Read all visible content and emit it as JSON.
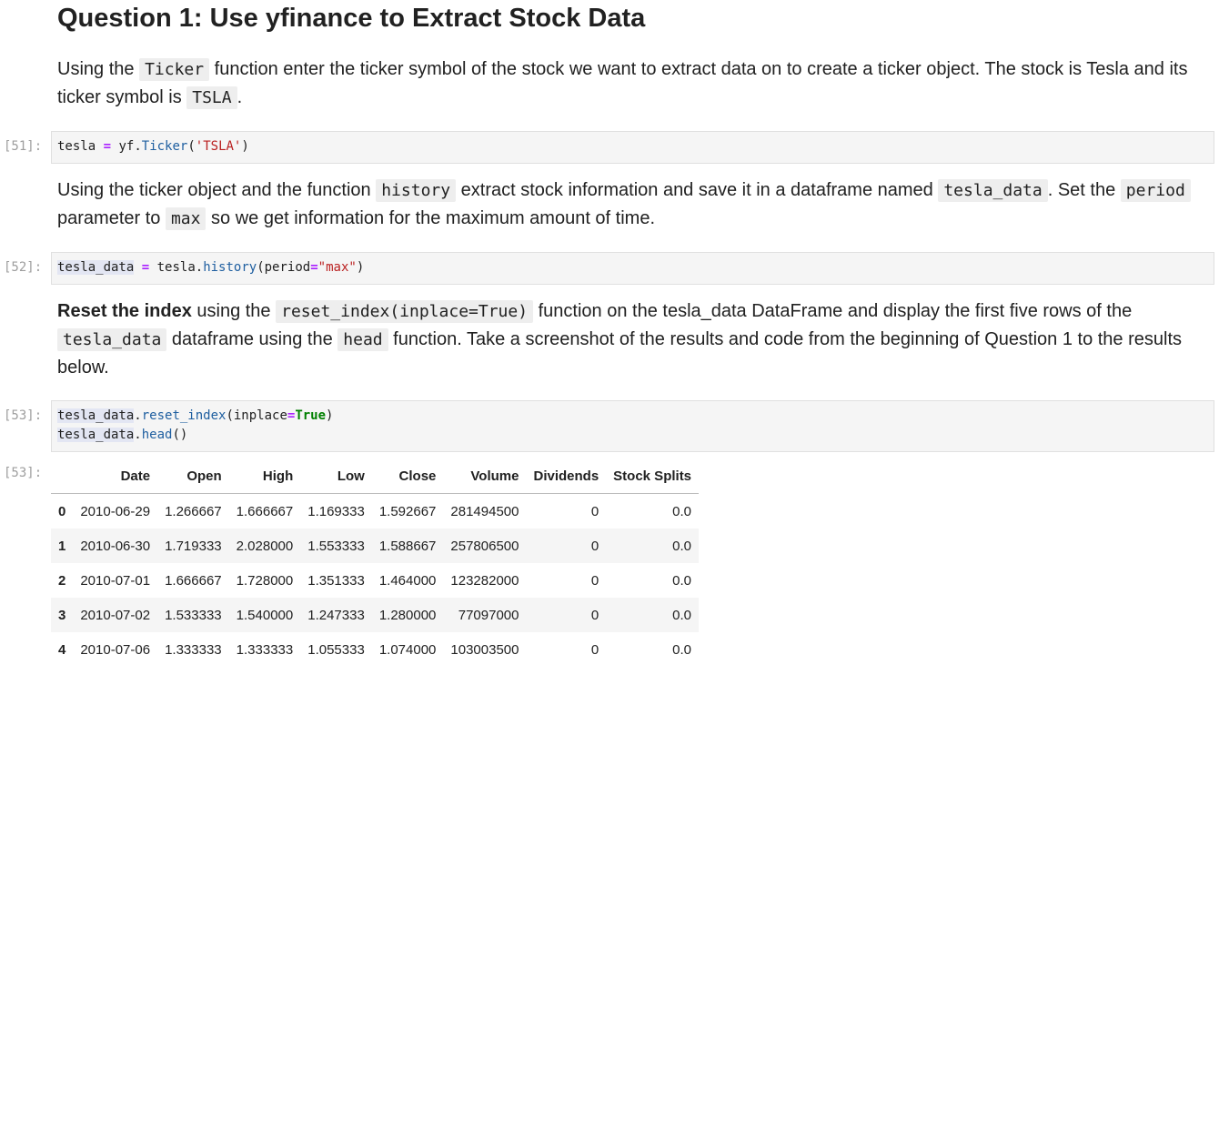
{
  "heading": "Question 1: Use yfinance to Extract Stock Data",
  "para1": {
    "t1": "Using the ",
    "c1": "Ticker",
    "t2": " function enter the ticker symbol of the stock we want to extract data on to create a ticker object. The stock is Tesla and its ticker symbol is ",
    "c2": "TSLA",
    "t3": "."
  },
  "cell51": {
    "prompt": "[51]:",
    "var": "tesla",
    "eq": "=",
    "obj": "yf.",
    "fn": "Ticker",
    "open": "(",
    "str": "'TSLA'",
    "close": ")"
  },
  "para2": {
    "t1": "Using the ticker object and the function ",
    "c1": "history",
    "t2": " extract stock information and save it in a dataframe named ",
    "c2": "tesla_data",
    "t3": ". Set the ",
    "c3": "period",
    "t4": " parameter to ",
    "c4": "max",
    "t5": " so we get information for the maximum amount of time."
  },
  "cell52": {
    "prompt": "[52]:",
    "var": "tesla_data",
    "eq": "=",
    "obj": "tesla.",
    "fn": "history",
    "arg": "(period",
    "eq2": "=",
    "str": "\"max\"",
    "close": ")"
  },
  "para3": {
    "bold": "Reset the index",
    "t1": " using the ",
    "c1": "reset_index(inplace=True)",
    "t2": " function on the tesla_data DataFrame and display the first five rows of the ",
    "c2": "tesla_data",
    "t3": " dataframe using the ",
    "c3": "head",
    "t4": " function. Take a screenshot of the results and code from the beginning of Question 1 to the results below."
  },
  "cell53": {
    "prompt": "[53]:",
    "l1_var": "tesla_data",
    "l1_dot": ".",
    "l1_fn": "reset_index",
    "l1_arg": "(inplace",
    "l1_eq": "=",
    "l1_kw": "True",
    "l1_close": ")",
    "l2_var": "tesla_data",
    "l2_dot": ".",
    "l2_fn": "head",
    "l2_close": "()"
  },
  "output53": {
    "prompt": "[53]:",
    "columns": [
      "",
      "Date",
      "Open",
      "High",
      "Low",
      "Close",
      "Volume",
      "Dividends",
      "Stock Splits"
    ],
    "rows": [
      [
        "0",
        "2010-06-29",
        "1.266667",
        "1.666667",
        "1.169333",
        "1.592667",
        "281494500",
        "0",
        "0.0"
      ],
      [
        "1",
        "2010-06-30",
        "1.719333",
        "2.028000",
        "1.553333",
        "1.588667",
        "257806500",
        "0",
        "0.0"
      ],
      [
        "2",
        "2010-07-01",
        "1.666667",
        "1.728000",
        "1.351333",
        "1.464000",
        "123282000",
        "0",
        "0.0"
      ],
      [
        "3",
        "2010-07-02",
        "1.533333",
        "1.540000",
        "1.247333",
        "1.280000",
        "77097000",
        "0",
        "0.0"
      ],
      [
        "4",
        "2010-07-06",
        "1.333333",
        "1.333333",
        "1.055333",
        "1.074000",
        "103003500",
        "0",
        "0.0"
      ]
    ]
  }
}
